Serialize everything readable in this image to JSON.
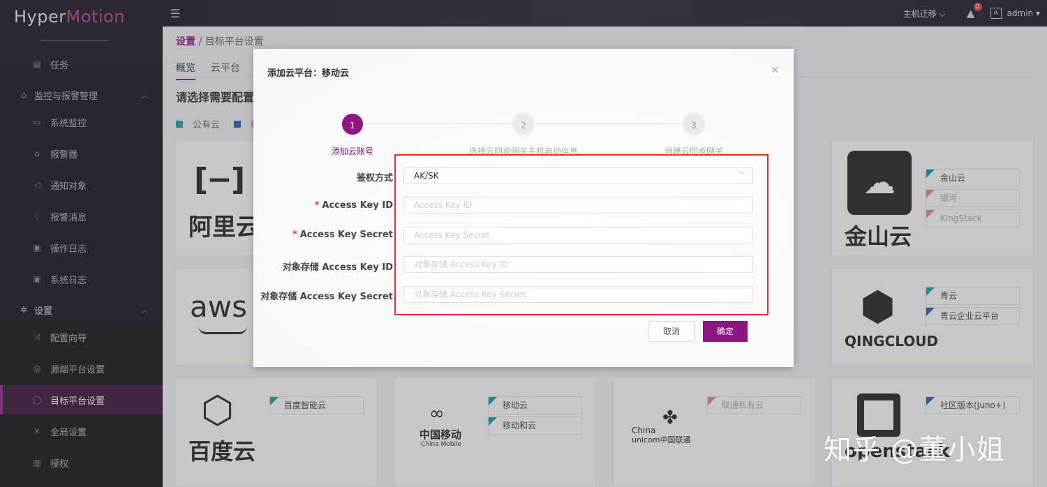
{
  "app": {
    "logo_a": "Hyper",
    "logo_b": "Motion"
  },
  "topbar": {
    "mode": "主机迁移",
    "mode_arrow": "⌵",
    "alert_count": "0",
    "lang_icon": "A",
    "user": "admin",
    "user_arrow": "▾"
  },
  "sidebar": {
    "items": [
      {
        "label": "任务"
      },
      {
        "label": "监控与报警管理"
      },
      {
        "label": "系统监控"
      },
      {
        "label": "报警器"
      },
      {
        "label": "通知对象"
      },
      {
        "label": "报警消息"
      },
      {
        "label": "操作日志"
      },
      {
        "label": "系统日志"
      },
      {
        "label": "设置"
      },
      {
        "label": "配置向导"
      },
      {
        "label": "源端平台设置"
      },
      {
        "label": "目标平台设置"
      },
      {
        "label": "全局设置"
      },
      {
        "label": "授权"
      }
    ]
  },
  "breadcrumb": {
    "parent": "设置",
    "sep": "/",
    "current": "目标平台设置"
  },
  "tabs": [
    {
      "label": "概览"
    },
    {
      "label": "云平台"
    }
  ],
  "page": {
    "heading": "请选择需要配置",
    "legend_public": "公有云",
    "legend_private": "私"
  },
  "cards": {
    "aliyun": "阿里云",
    "aws": "aws",
    "baidu": "百度云",
    "baidu_tag": "百度智能云",
    "mobile_cn": "中国移动",
    "mobile_en": "China Mobile",
    "mobile_tag1": "移动云",
    "mobile_tag2": "移动和云",
    "unicom_a": "China",
    "unicom_b": "unicom中国联通",
    "unicom_tag": "联通私有云",
    "kingsoft": "金山云",
    "kingsoft_tags": [
      "金山云",
      "银河",
      "KingStack"
    ],
    "qingcloud": "QINGCLOUD",
    "qing_tags": [
      "青云",
      "青云企业云平台"
    ],
    "openstack": "openstack",
    "openstack_tag": "社区版本(Juno+)"
  },
  "dialog": {
    "title": "添加云平台：移动云",
    "close": "×",
    "steps": [
      {
        "num": "1",
        "label": "添加云账号"
      },
      {
        "num": "2",
        "label": "选择云同步网关主机启动信息"
      },
      {
        "num": "3",
        "label": "创建云同步网关"
      }
    ],
    "fields": [
      {
        "label": "鉴权方式",
        "required": false,
        "value": "AK/SK",
        "placeholder": ""
      },
      {
        "label": "Access Key ID",
        "required": true,
        "value": "",
        "placeholder": "Access Key ID"
      },
      {
        "label": "Access Key Secret",
        "required": true,
        "value": "",
        "placeholder": "Access Key Secret"
      },
      {
        "label": "对象存储 Access Key ID",
        "required": false,
        "value": "",
        "placeholder": "对象存储 Access Key ID"
      },
      {
        "label": "对象存储 Access Key Secret",
        "required": false,
        "value": "",
        "placeholder": "对象存储 Access Key Secret"
      }
    ],
    "required_mark": "*",
    "cancel": "取消",
    "confirm": "确定"
  },
  "watermark": "知乎 @董小姐",
  "colors": {
    "accent": "#8c1682",
    "public_cloud": "#1aa0a0",
    "private_cloud": "#2e5ab8",
    "highlight": "#e0342c"
  }
}
